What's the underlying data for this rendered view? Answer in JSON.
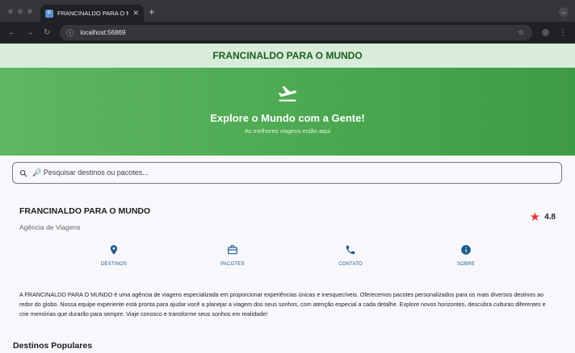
{
  "browser": {
    "tab_title": "FRANCINALDO PARA O MUNDO",
    "url": "localhost:56869"
  },
  "app": {
    "title": "FRANCINALDO PARA O MUNDO"
  },
  "hero": {
    "icon": "flight-takeoff-icon",
    "title": "Explore o Mundo com a Gente!",
    "subtitle": "As melhores viagens estão aqui"
  },
  "search": {
    "placeholder": "🔎 Pesquisar destinos ou pacotes..."
  },
  "company": {
    "name": "FRANCINALDO PARA O MUNDO",
    "type": "Agência de Viagens",
    "rating": "4.8"
  },
  "actions": [
    {
      "label": "DESTINOS",
      "icon": "location-pin-icon"
    },
    {
      "label": "PACOTES",
      "icon": "briefcase-icon"
    },
    {
      "label": "CONTATO",
      "icon": "phone-icon"
    },
    {
      "label": "SOBRE",
      "icon": "info-icon"
    }
  ],
  "about": "A FRANCINALDO PARA O MUNDO é uma agência de viagens especializada em proporcionar experiências únicas e inesquecíveis. Oferecemos pacotes personalizados para os mais diversos destinos ao redor do globo. Nossa equipe experiente está pronta para ajudar você a planejar a viagem dos seus sonhos, com atenção especial a cada detalhe. Explore novos horizontes, descubra culturas diferentes e crie memórias que durarão para sempre. Viaje conosco e transforme seus sonhos em realidade!",
  "sections": {
    "popular": "Destinos Populares"
  },
  "colors": {
    "primary": "#1b5e20",
    "hero": "#4caf50",
    "accent": "#1e5a8c",
    "star": "#e53935"
  }
}
